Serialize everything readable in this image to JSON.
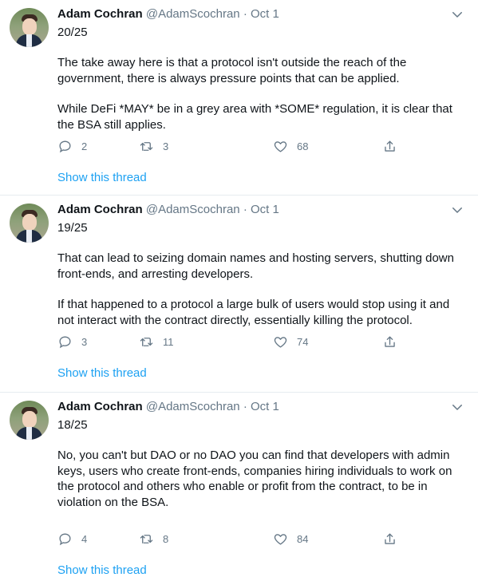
{
  "tweets": [
    {
      "author": "Adam Cochran",
      "handle": "@AdamScochran",
      "separator": "·",
      "date": "Oct 1",
      "position": "20/25",
      "paragraphs": [
        "The take away here is that a protocol isn't outside the reach of the government, there is always pressure points that can be applied.",
        "While DeFi *MAY* be in a grey area with *SOME* regulation, it is clear that the BSA still applies."
      ],
      "replies": "2",
      "retweets": "3",
      "likes": "68",
      "show_thread": "Show this thread"
    },
    {
      "author": "Adam Cochran",
      "handle": "@AdamScochran",
      "separator": "·",
      "date": "Oct 1",
      "position": "19/25",
      "paragraphs": [
        "That can lead to seizing domain names and hosting servers, shutting down front-ends, and arresting developers.",
        "If that happened to a protocol a large bulk of users would stop using it and not interact with the contract directly, essentially killing the protocol."
      ],
      "replies": "3",
      "retweets": "11",
      "likes": "74",
      "show_thread": "Show this thread"
    },
    {
      "author": "Adam Cochran",
      "handle": "@AdamScochran",
      "separator": "·",
      "date": "Oct 1",
      "position": "18/25",
      "paragraphs": [
        "No, you can't but DAO or no DAO you can find that developers with admin keys, users who create front-ends, companies hiring individuals to work on the protocol and others who enable or profit from the contract, to be in violation on the BSA."
      ],
      "replies": "4",
      "retweets": "8",
      "likes": "84",
      "show_thread": "Show this thread"
    }
  ],
  "icons": {
    "reply": "reply-icon",
    "retweet": "retweet-icon",
    "like": "heart-icon",
    "share": "share-icon",
    "more": "chevron-down-icon"
  },
  "colors": {
    "link": "#1da1f2",
    "muted": "#657786",
    "divider": "#e6ecf0"
  }
}
